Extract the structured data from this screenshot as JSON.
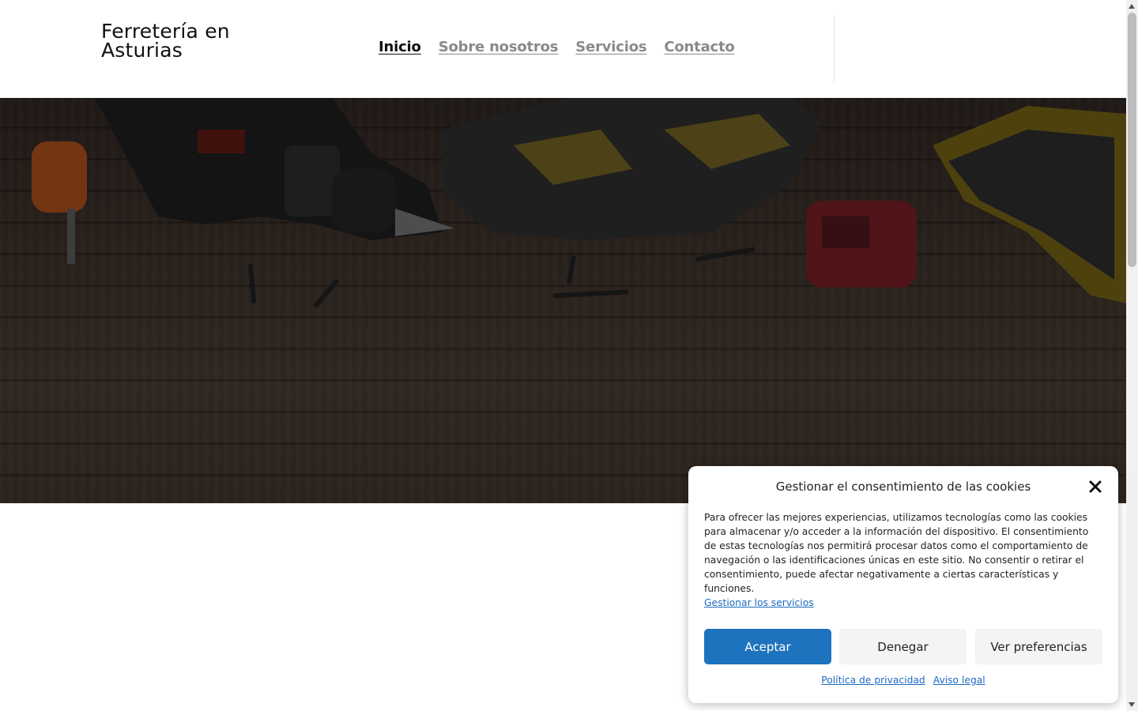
{
  "header": {
    "site_title": "Ferretería en Asturias",
    "nav": [
      {
        "label": "Inicio",
        "active": true
      },
      {
        "label": "Sobre nosotros",
        "active": false
      },
      {
        "label": "Servicios",
        "active": false
      },
      {
        "label": "Contacto",
        "active": false
      }
    ]
  },
  "hero": {
    "image": "hardware-tools-on-wooden-table"
  },
  "cookie_dialog": {
    "title": "Gestionar el consentimiento de las cookies",
    "body": "Para ofrecer las mejores experiencias, utilizamos tecnologías como las cookies para almacenar y/o acceder a la información del dispositivo. El consentimiento de estas tecnologías nos permitirá procesar datos como el comportamiento de navegación o las identificaciones únicas en este sitio. No consentir o retirar el consentimiento, puede afectar negativamente a ciertas características y funciones.",
    "manage_link": "Gestionar los servicios",
    "accept_label": "Aceptar",
    "deny_label": "Denegar",
    "preferences_label": "Ver preferencias",
    "privacy_link": "Política de privacidad",
    "legal_link": "Aviso legal",
    "close_icon": "close-icon"
  },
  "colors": {
    "accent": "#1e73be",
    "nav_active": "#111111",
    "nav_inactive": "#8a8a8a"
  }
}
